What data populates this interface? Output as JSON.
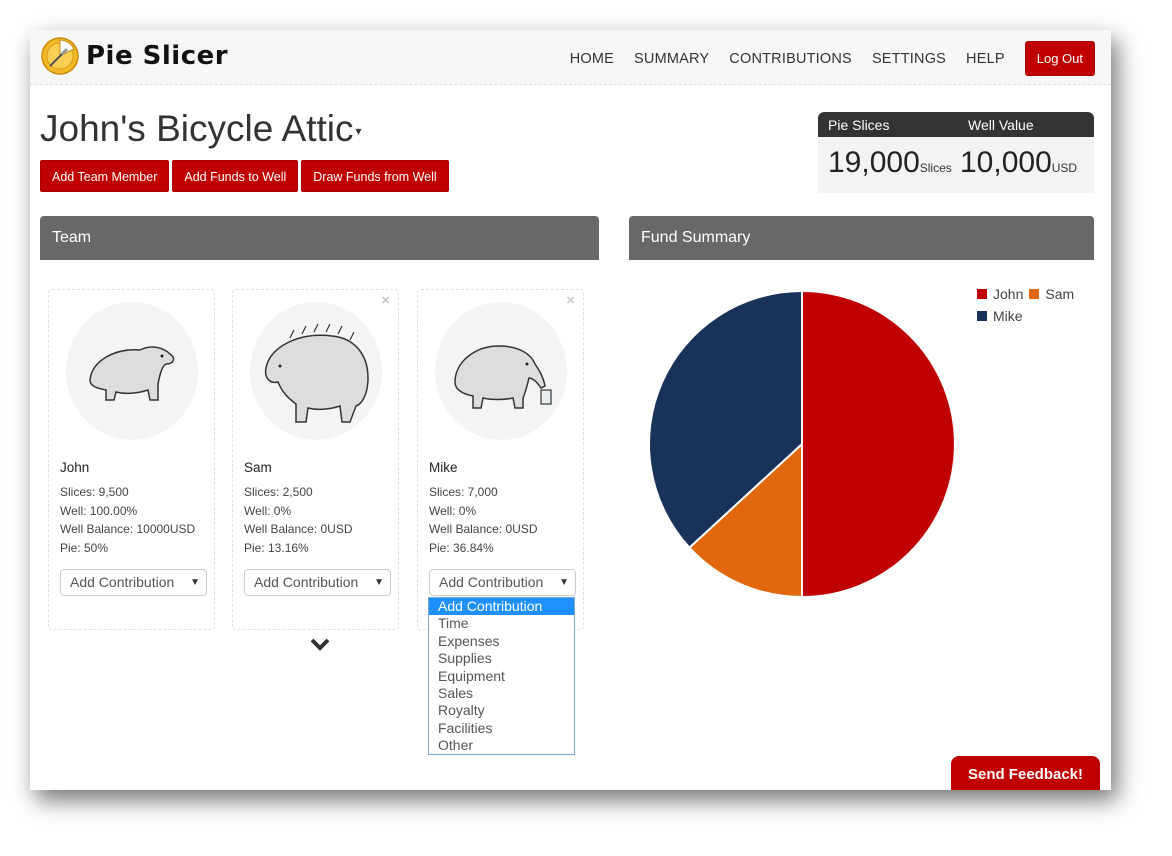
{
  "app": {
    "name": "Pie Slicer"
  },
  "nav": {
    "links": [
      "HOME",
      "SUMMARY",
      "CONTRIBUTIONS",
      "SETTINGS",
      "HELP"
    ],
    "logout": "Log Out"
  },
  "project": {
    "title": "John's Bicycle Attic",
    "caret": "▾"
  },
  "actions": {
    "add_member": "Add Team Member",
    "add_funds": "Add Funds to Well",
    "draw_funds": "Draw Funds from Well"
  },
  "stats": {
    "pie_label": "Pie Slices",
    "well_label": "Well Value",
    "pie_value": "19,000",
    "pie_unit": "Slices",
    "well_value": "10,000",
    "well_unit": "USD"
  },
  "team": {
    "title": "Team",
    "members": [
      {
        "name": "John",
        "slices": "Slices: 9,500",
        "well": "Well: 100.00%",
        "balance": "Well Balance: 10000USD",
        "pie": "Pie: 50%",
        "select": "Add Contribution"
      },
      {
        "name": "Sam",
        "slices": "Slices: 2,500",
        "well": "Well: 0%",
        "balance": "Well Balance: 0USD",
        "pie": "Pie: 13.16%",
        "select": "Add Contribution"
      },
      {
        "name": "Mike",
        "slices": "Slices: 7,000",
        "well": "Well: 0%",
        "balance": "Well Balance: 0USD",
        "pie": "Pie: 36.84%",
        "select": "Add Contribution"
      }
    ],
    "remove_icon": "×",
    "dropdown_options": [
      "Add Contribution",
      "Time",
      "Expenses",
      "Supplies",
      "Equipment",
      "Sales",
      "Royalty",
      "Facilities",
      "Other"
    ]
  },
  "fund_summary": {
    "title": "Fund Summary"
  },
  "chart_data": {
    "type": "pie",
    "categories": [
      "John",
      "Sam",
      "Mike"
    ],
    "values": [
      9500,
      2500,
      7000
    ],
    "colors": [
      "#c00000",
      "#e2680f",
      "#193259"
    ],
    "legend_position": "top-right"
  },
  "feedback": {
    "label": "Send Feedback!"
  }
}
